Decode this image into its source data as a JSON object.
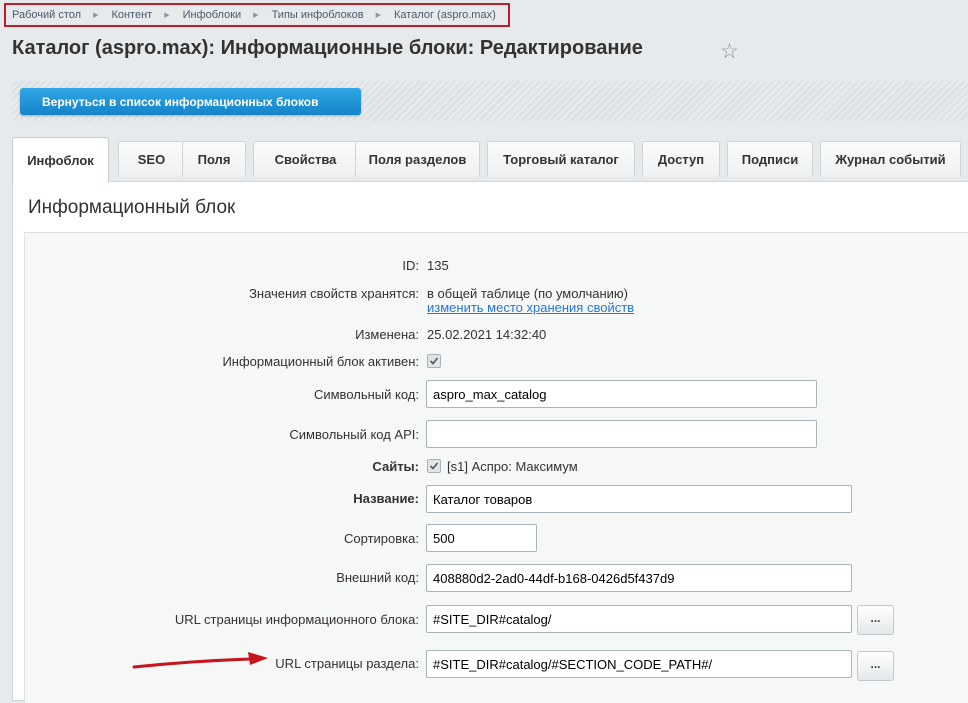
{
  "breadcrumb": [
    "Рабочий стол",
    "Контент",
    "Инфоблоки",
    "Типы инфоблоков",
    "Каталог (aspro.max)"
  ],
  "page_title": "Каталог (aspro.max): Информационные блоки: Редактирование",
  "toolbar": {
    "back_label": "Вернуться в список информационных блоков"
  },
  "tabs": [
    "Инфоблок",
    "SEO",
    "Поля",
    "Свойства",
    "Поля разделов",
    "Торговый каталог",
    "Доступ",
    "Подписи",
    "Журнал событий"
  ],
  "section_title": "Информационный блок",
  "fields": {
    "id": {
      "label": "ID:",
      "value": "135"
    },
    "storage": {
      "label": "Значения свойств хранятся:",
      "value": "в общей таблице (по умолчанию)",
      "link": "изменить место хранения свойств"
    },
    "modified": {
      "label": "Изменена:",
      "value": "25.02.2021 14:32:40"
    },
    "active": {
      "label": "Информационный блок активен:",
      "checked": true
    },
    "code": {
      "label": "Символьный код:",
      "value": "aspro_max_catalog"
    },
    "api_code": {
      "label": "Символьный код API:",
      "value": ""
    },
    "sites": {
      "label": "Сайты:",
      "value": "[s1] Аспро: Максимум",
      "checked": true
    },
    "name": {
      "label": "Название:",
      "value": "Каталог товаров"
    },
    "sort": {
      "label": "Сортировка:",
      "value": "500"
    },
    "external_code": {
      "label": "Внешний код:",
      "value": "408880d2-2ad0-44df-b168-0426d5f437d9"
    },
    "list_url": {
      "label": "URL страницы информационного блока:",
      "value": "#SITE_DIR#catalog/",
      "button": "..."
    },
    "section_url": {
      "label": "URL страницы раздела:",
      "value": "#SITE_DIR#catalog/#SECTION_CODE_PATH#/",
      "button": "..."
    }
  },
  "colors": {
    "accent": "#1a8fd6",
    "highlight": "#b9202a",
    "link": "#2675d7"
  }
}
